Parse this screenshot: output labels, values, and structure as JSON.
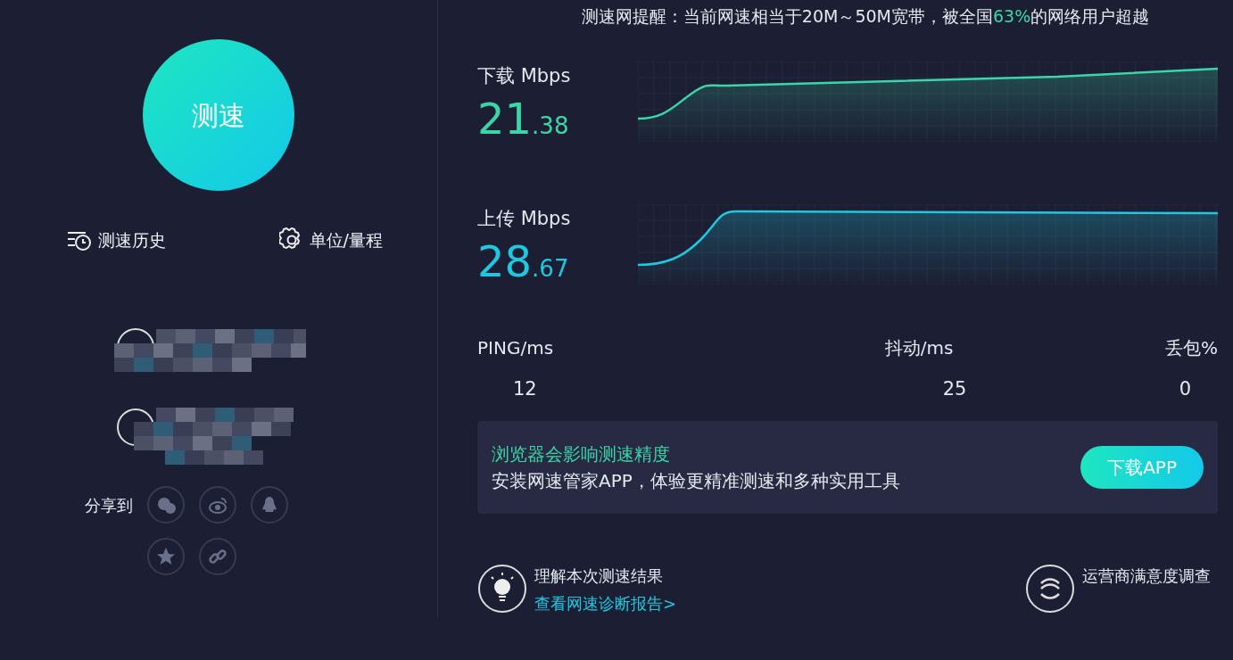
{
  "start_button": {
    "label": "测速"
  },
  "actions": [
    {
      "kind": "history",
      "label": "测速历史"
    },
    {
      "kind": "settings",
      "label": "单位/量程"
    }
  ],
  "share": {
    "label": "分享到",
    "targets": [
      {
        "kind": "wechat"
      },
      {
        "kind": "weibo"
      },
      {
        "kind": "qq"
      },
      {
        "kind": "favorite"
      },
      {
        "kind": "link"
      }
    ]
  },
  "notice": {
    "before": "测速网提醒：当前网速相当于20M～50M宽带，被全国",
    "highlight": "63%",
    "after": "的网络用户超越"
  },
  "speeds": [
    {
      "kind": "download",
      "label": "下载 Mbps",
      "integer": "21",
      "decimal": ".38",
      "color": "#3ad6a8"
    },
    {
      "kind": "upload",
      "label": "上传 Mbps",
      "integer": "28",
      "decimal": ".67",
      "color": "#1ec8e0"
    }
  ],
  "stats": [
    {
      "label": "PING/ms",
      "value": "12"
    },
    {
      "label": "抖动/ms",
      "value": "25"
    },
    {
      "label": "丢包%",
      "value": "0"
    }
  ],
  "banner": {
    "title": "浏览器会影响测速精度",
    "text": "安装网速管家APP，体验更精准测速和多种实用工具",
    "button": "下载APP"
  },
  "footer": [
    {
      "kind": "bulb",
      "title": "理解本次测速结果",
      "link": "查看网速诊断报告>"
    },
    {
      "kind": "operator",
      "title": "运营商满意度调查"
    }
  ]
}
